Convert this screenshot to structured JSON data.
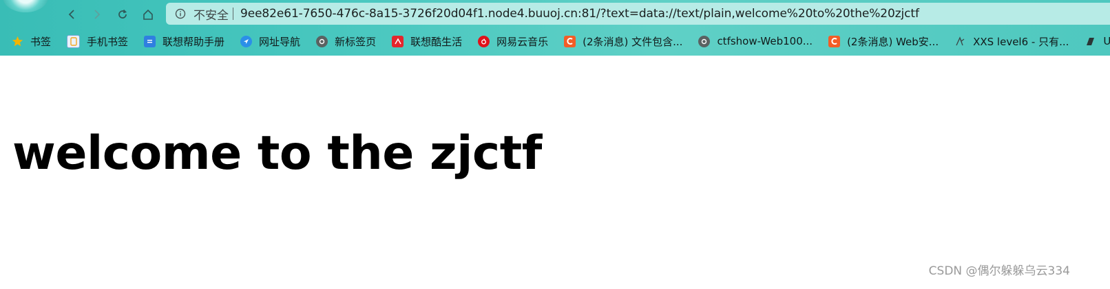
{
  "browser": {
    "security_label": "不安全",
    "url": "9ee82e61-7650-476c-8a15-3726f20d04f1.node4.buuoj.cn:81/?text=data://text/plain,welcome%20to%20the%20zjctf"
  },
  "bookmarks": [
    {
      "label": "书签",
      "icon": "star-icon"
    },
    {
      "label": "手机书签",
      "icon": "phone-icon"
    },
    {
      "label": "联想帮助手册",
      "icon": "manual-icon"
    },
    {
      "label": "网址导航",
      "icon": "compass-icon"
    },
    {
      "label": "新标签页",
      "icon": "new-tab-icon"
    },
    {
      "label": "联想酷生活",
      "icon": "lenovo-icon"
    },
    {
      "label": "网易云音乐",
      "icon": "netease-music-icon"
    },
    {
      "label": "(2条消息) 文件包含...",
      "icon": "csdn-icon"
    },
    {
      "label": "ctfshow-Web100...",
      "icon": "ctfshow-icon"
    },
    {
      "label": "(2条消息) Web安...",
      "icon": "csdn-icon"
    },
    {
      "label": "XXS level6 - 只有...",
      "icon": "xss-icon"
    },
    {
      "label": "Up",
      "icon": "bookmark-icon"
    }
  ],
  "page": {
    "heading": "welcome to the zjctf"
  },
  "watermark": "CSDN @偶尔躲躲乌云334",
  "colors": {
    "toolbar": "#48c7bf",
    "address_bar": "#b7ebe6",
    "csdn": "#f25d27",
    "netease": "#e0121b"
  }
}
